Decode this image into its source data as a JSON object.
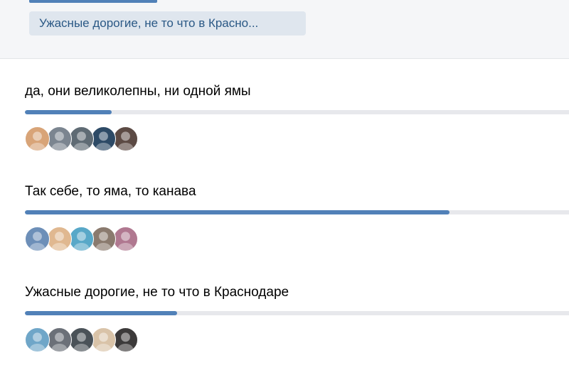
{
  "selected_answer": {
    "label": "Ужасные дорогие, не то что в Красно..."
  },
  "poll": {
    "options": [
      {
        "label": "да, они великолепны, ни одной ямы",
        "share": 0.16,
        "voter_colors": [
          "#d8a478",
          "#7b8590",
          "#5f6b74",
          "#2d4a66",
          "#5c4a44"
        ]
      },
      {
        "label": "Так себе, то яма, то канава",
        "share": 0.78,
        "voter_colors": [
          "#6d8fb8",
          "#e0b890",
          "#58a8c8",
          "#8a7a6e",
          "#b07890"
        ]
      },
      {
        "label": "Ужасные дорогие, не то что в Краснодаре",
        "share": 0.28,
        "voter_colors": [
          "#6fa6c8",
          "#6b7078",
          "#4a5258",
          "#d9c3a8",
          "#3c3a3a"
        ]
      }
    ]
  },
  "colors": {
    "accent": "#5181b8",
    "track": "#e7e8ec",
    "chip_bg": "#dfe6ee",
    "chip_text": "#2a5885"
  }
}
